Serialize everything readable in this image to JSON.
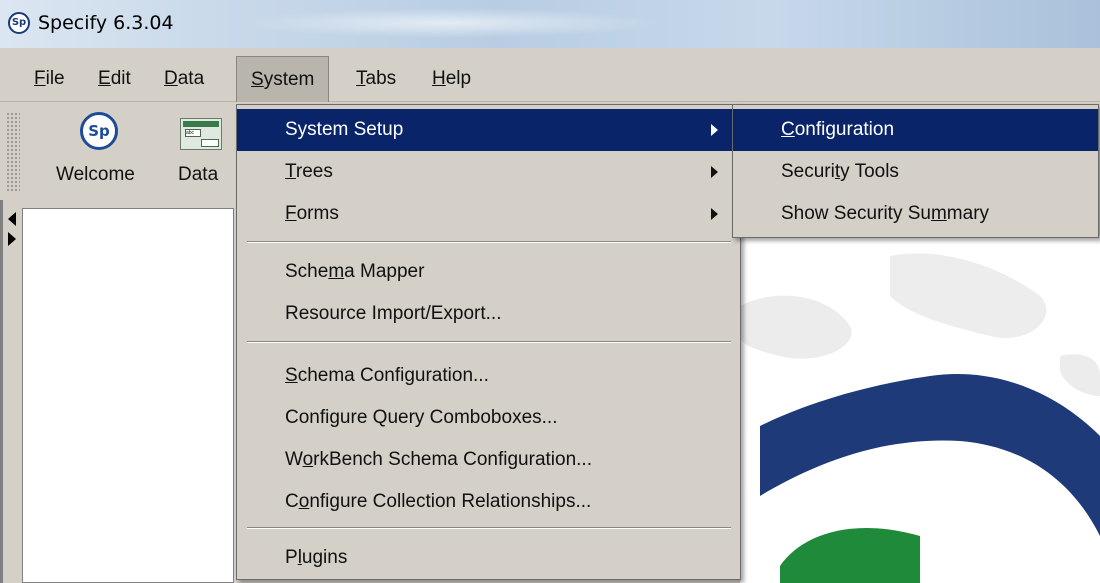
{
  "window": {
    "title": "Specify 6.3.04",
    "logo_text": "Sp"
  },
  "menubar": {
    "items": [
      {
        "label": "File",
        "mnemonic": "F",
        "rest": "ile"
      },
      {
        "label": "Edit",
        "mnemonic": "E",
        "rest": "dit"
      },
      {
        "label": "Data",
        "mnemonic": "D",
        "rest": "ata"
      },
      {
        "label": "System",
        "mnemonic": "S",
        "rest": "ystem",
        "active": true
      },
      {
        "label": "Tabs",
        "mnemonic": "T",
        "rest": "abs"
      },
      {
        "label": "Help",
        "mnemonic": "H",
        "rest": "elp"
      }
    ]
  },
  "toolbar": {
    "welcome_label": "Welcome",
    "data_label": "Data",
    "sp_icon_text": "Sp",
    "data_icon_text": "abc"
  },
  "system_menu": {
    "items": [
      {
        "pre": "System Setup",
        "u": "",
        "post": "",
        "submenu": true,
        "highlighted": true
      },
      {
        "pre": "",
        "u": "T",
        "post": "rees",
        "submenu": true
      },
      {
        "pre": "",
        "u": "F",
        "post": "orms",
        "submenu": true
      },
      {
        "separator": true
      },
      {
        "pre": "Sche",
        "u": "m",
        "post": "a Mapper"
      },
      {
        "pre": "Resource Import/Export...",
        "u": "",
        "post": ""
      },
      {
        "separator": true
      },
      {
        "pre": "",
        "u": "S",
        "post": "chema Configuration..."
      },
      {
        "pre": "Configure Query Comboboxes...",
        "u": "",
        "post": ""
      },
      {
        "pre": "W",
        "u": "o",
        "post": "rkBench Schema Configuration..."
      },
      {
        "pre": "C",
        "u": "o",
        "post": "nfigure Collection Relationships..."
      },
      {
        "separator": true
      },
      {
        "pre": "P",
        "u": "l",
        "post": "ugins"
      }
    ]
  },
  "setup_submenu": {
    "items": [
      {
        "pre": "",
        "u": "C",
        "post": "onfiguration",
        "highlighted": true
      },
      {
        "pre": "Securi",
        "u": "t",
        "post": "y Tools"
      },
      {
        "pre": "Show Security Su",
        "u": "m",
        "post": "mary"
      }
    ]
  },
  "colors": {
    "highlight": "#0a246a",
    "menu_bg": "#d4d0c8",
    "logo_blue": "#1e3a78",
    "logo_green": "#1f8a3a"
  }
}
